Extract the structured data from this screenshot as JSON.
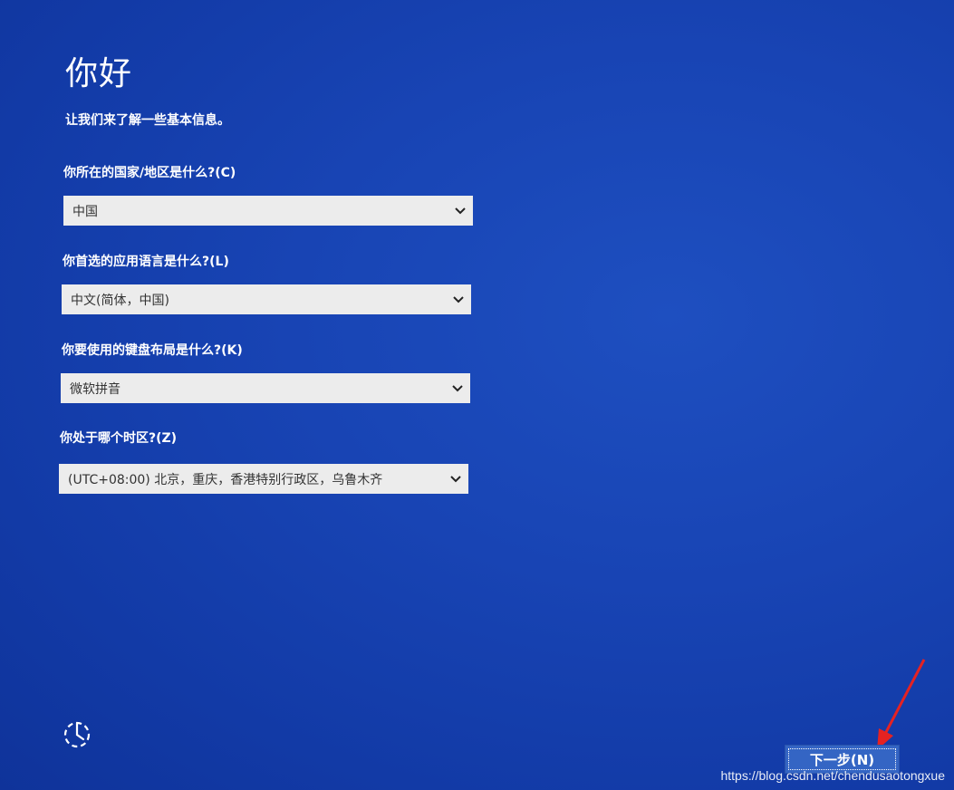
{
  "page": {
    "title": "你好",
    "subtitle": "让我们来了解一些基本信息。"
  },
  "form": {
    "country_label": "你所在的国家/地区是什么?(C)",
    "country_value": "中国",
    "language_label": "你首选的应用语言是什么?(L)",
    "language_value": "中文(简体，中国)",
    "keyboard_label": "你要使用的键盘布局是什么?(K)",
    "keyboard_value": "微软拼音",
    "timezone_label": "你处于哪个时区?(Z)",
    "timezone_value": "(UTC+08:00) 北京，重庆，香港特别行政区，乌鲁木齐"
  },
  "footer": {
    "next_label": "下一步(N)",
    "power_icon": "accessibility-icon",
    "watermark": "https://blog.csdn.net/chendusaotongxue"
  },
  "colors": {
    "background": "#1844b4",
    "dropdown": "#ececec",
    "button": "#3465c4",
    "annotation_arrow": "#e52222"
  }
}
